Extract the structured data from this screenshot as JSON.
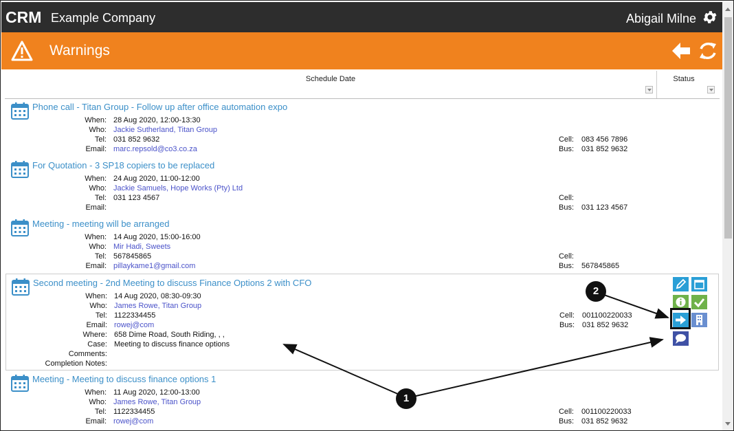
{
  "header": {
    "logo_text": "CRM",
    "company": "Example Company",
    "user": "Abigail Milne"
  },
  "page": {
    "title": "Warnings"
  },
  "columns": {
    "schedule_date": "Schedule Date",
    "status": "Status"
  },
  "labels": {
    "when": "When:",
    "who": "Who:",
    "tel": "Tel:",
    "email": "Email:",
    "where": "Where:",
    "case": "Case:",
    "comments": "Comments:",
    "completion": "Completion Notes:",
    "cell": "Cell:",
    "bus": "Bus:"
  },
  "records": [
    {
      "title": "Phone call - Titan Group - Follow up after office automation expo",
      "when": "28 Aug 2020, 12:00-13:30",
      "who": "Jackie Sutherland, Titan Group",
      "tel": "031 852 9632",
      "email": "marc.repsold@co3.co.za",
      "cell": "083 456 7896",
      "bus": "031 852 9632"
    },
    {
      "title": "For Quotation - 3 SP18 copiers to be replaced",
      "when": "24 Aug 2020, 11:00-12:00",
      "who": "Jackie Samuels, Hope Works (Pty) Ltd",
      "tel": "031 123 4567",
      "email": "",
      "cell": "",
      "bus": "031 123 4567"
    },
    {
      "title": "Meeting - meeting will be arranged",
      "when": "14 Aug 2020, 15:00-16:00",
      "who": "Mir Hadi, Sweets",
      "tel": "567845865",
      "email": "pillaykame1@gmail.com",
      "cell": "",
      "bus": "567845865"
    },
    {
      "title": "Second meeting - 2nd Meeting to discuss Finance Options 2 with CFO",
      "when": "14 Aug 2020, 08:30-09:30",
      "who": "James Rowe, Titan Group",
      "tel": "1122334455",
      "email": "rowej@com",
      "where": "658 Dime Road, South Riding, , ,",
      "case": "Meeting to discuss finance options",
      "comments": "",
      "completion": "",
      "cell": "001100220033",
      "bus": "031 852 9632"
    },
    {
      "title": "Meeting - Meeting to discuss finance options 1",
      "when": "11 Aug 2020, 12:00-13:00",
      "who": "James Rowe, Titan Group",
      "tel": "1122334455",
      "email": "rowej@com",
      "cell": "001100220033",
      "bus": "031 852 9632"
    }
  ],
  "actions": [
    {
      "name": "edit-icon",
      "color": "#2a9fd6"
    },
    {
      "name": "calendar-icon",
      "color": "#2a9fd6"
    },
    {
      "name": "info-icon",
      "color": "#6fb24a"
    },
    {
      "name": "check-icon",
      "color": "#6fb24a"
    },
    {
      "name": "forward-arrow-icon",
      "color": "#2a9fd6"
    },
    {
      "name": "company-building-icon",
      "color": "#6a8fd0"
    },
    {
      "name": "chat-icon",
      "color": "#3f51a5"
    }
  ],
  "callouts": {
    "one": "1",
    "two": "2"
  }
}
